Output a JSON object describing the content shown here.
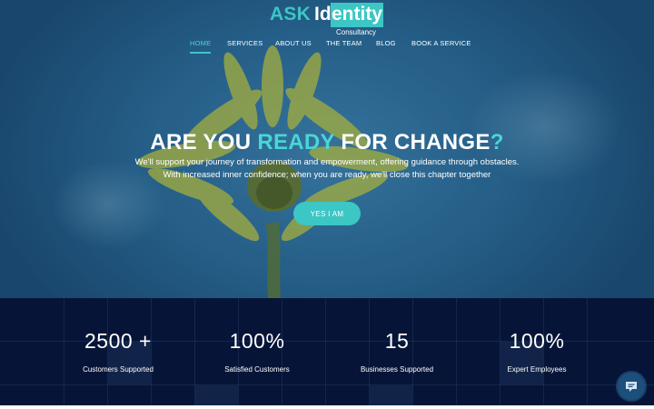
{
  "brand": {
    "part1": "ASK",
    "part2": "Id",
    "part3": "entity",
    "subtitle": "Consultancy",
    "accent_color": "#3cc6c4"
  },
  "nav": {
    "items": [
      {
        "label": "HOME",
        "active": true
      },
      {
        "label": "SERVICES"
      },
      {
        "label": "ABOUT US"
      },
      {
        "label": "THE TEAM"
      },
      {
        "label": "BLOG"
      },
      {
        "label": "BOOK A SERVICE"
      }
    ]
  },
  "hero": {
    "headline_start": "ARE YOU ",
    "headline_accent": "READY",
    "headline_end": " FOR CHANGE",
    "headline_mark": "?",
    "subtitle_line1": "We'll support your journey of transformation and empowerment, offering guidance through obstacles.",
    "subtitle_line2": "With increased inner confidence; when you are ready, we'll close this chapter together",
    "cta_label": "YES I AM"
  },
  "stats": [
    {
      "value": "2500 +",
      "label": "Customers Supported"
    },
    {
      "value": "100%",
      "label": "Satisfied Customers"
    },
    {
      "value": "15",
      "label": "Businesses Supported"
    },
    {
      "value": "100%",
      "label": "Expert Employees"
    }
  ],
  "chat": {
    "icon": "chat-icon",
    "color": "#1c4f7c"
  }
}
